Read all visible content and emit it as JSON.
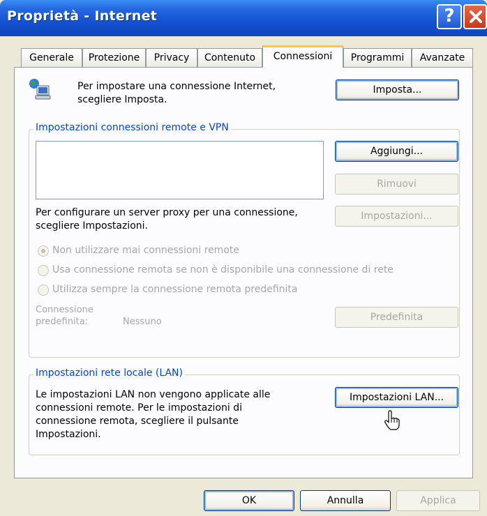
{
  "window": {
    "title": "Proprietà - Internet",
    "help_button": "?",
    "close_button": "✕"
  },
  "tabs": [
    {
      "label": "Generale"
    },
    {
      "label": "Protezione"
    },
    {
      "label": "Privacy"
    },
    {
      "label": "Contenuto"
    },
    {
      "label": "Connessioni",
      "active": true
    },
    {
      "label": "Programmi"
    },
    {
      "label": "Avanzate"
    }
  ],
  "setup": {
    "icon": "network-computer-icon",
    "text_line1": "Per impostare una connessione Internet,",
    "text_line2": "scegliere Imposta.",
    "button": "Imposta..."
  },
  "remote": {
    "group_title": "Impostazioni connessioni remote e VPN",
    "connections": [],
    "add_button": "Aggiungi...",
    "remove_button": "Rimuovi",
    "settings_button": "Impostazioni...",
    "proxy_text_line1": "Per configurare un server proxy per una connessione,",
    "proxy_text_line2": "scegliere Impostazioni.",
    "radios": [
      {
        "label": "Non utilizzare mai connessioni remote",
        "checked": true
      },
      {
        "label": "Usa connessione remota se non è disponibile una connessione di rete",
        "checked": false
      },
      {
        "label": "Utilizza sempre la connessione remota predefinita",
        "checked": false
      }
    ],
    "default_label_line1": "Connessione",
    "default_label_line2": "predefinita:",
    "default_value": "Nessuno",
    "default_button": "Predefinita"
  },
  "lan": {
    "group_title": "Impostazioni rete locale (LAN)",
    "text_line1": "Le impostazioni LAN non vengono applicate alle",
    "text_line2": "connessioni remote. Per le impostazioni di",
    "text_line3": "connessione remota, scegliere il pulsante",
    "text_line4": "Impostazioni.",
    "button": "Impostazioni LAN..."
  },
  "footer": {
    "ok": "OK",
    "cancel": "Annulla",
    "apply": "Applica"
  },
  "colors": {
    "titlebar": "#1452d1",
    "dialog_bg": "#ece9d8",
    "group_title": "#0046d5",
    "active_tab_accent": "#ffc83c"
  }
}
